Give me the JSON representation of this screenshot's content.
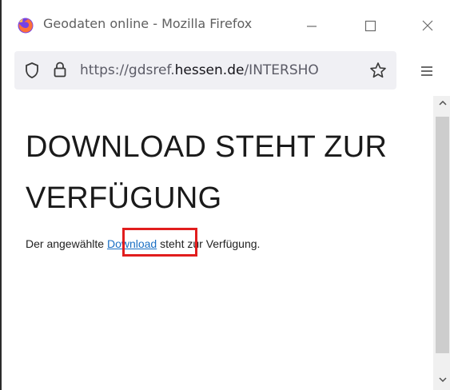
{
  "window": {
    "title": "Geodaten online - Mozilla Firefox"
  },
  "urlbar": {
    "prefix": "https://gdsref.",
    "domain": "hessen.de",
    "suffix": "/INTERSHO"
  },
  "page": {
    "heading_line1": "DOWNLOAD STEHT ZUR",
    "heading_line2": "VERFÜGUNG",
    "text_before": "Der angewählte ",
    "link_label": "Download",
    "text_after": " steht zur Verfügung."
  },
  "colors": {
    "highlight": "#e11d1d",
    "link": "#1a6fc4"
  },
  "icons": [
    "firefox-icon",
    "minimize-icon",
    "maximize-icon",
    "close-icon",
    "shield-icon",
    "lock-icon",
    "star-icon",
    "hamburger-menu-icon",
    "scroll-up-icon",
    "scroll-down-icon"
  ]
}
